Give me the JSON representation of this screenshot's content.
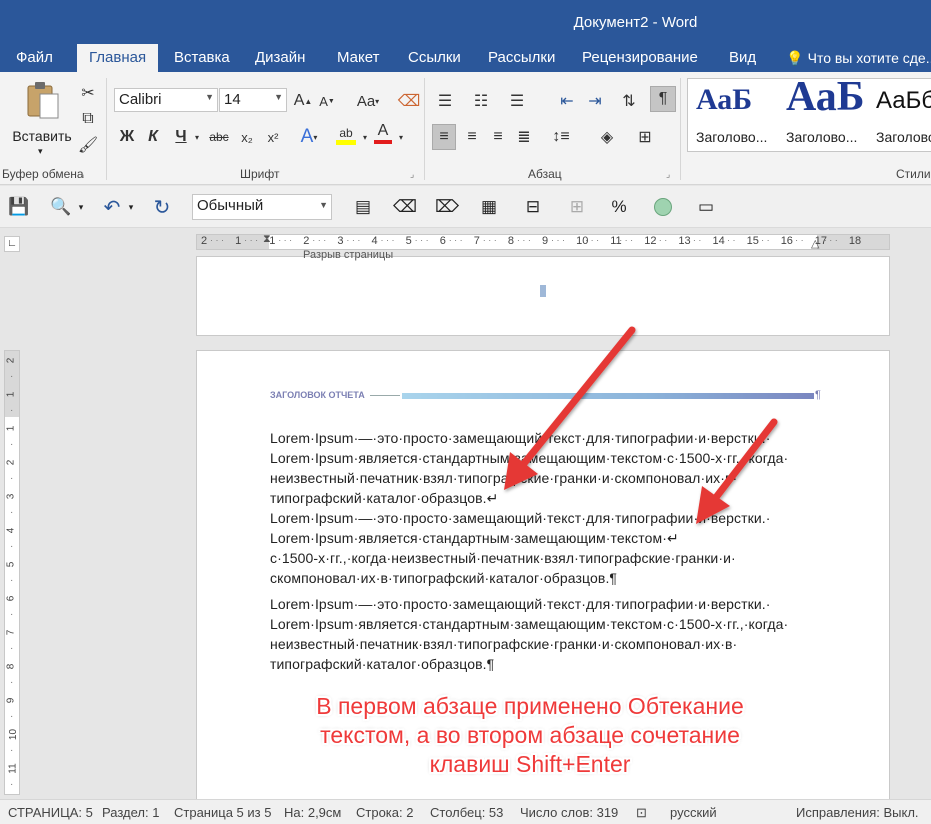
{
  "titlebar": {
    "title": "Документ2 - Word"
  },
  "tabs": [
    "Файл",
    "Главная",
    "Вставка",
    "Дизайн",
    "Макет",
    "Ссылки",
    "Рассылки",
    "Рецензирование",
    "Вид"
  ],
  "tell_me": "Что вы хотите сде...",
  "ribbon": {
    "clipboard": {
      "paste_label": "Вставить",
      "group_label": "Буфер обмена"
    },
    "font": {
      "font_name": "Calibri",
      "font_size": "14",
      "bold": "Ж",
      "italic": "К",
      "underline": "Ч",
      "strike": "abc",
      "grow": "A",
      "shrink": "A",
      "case": "Aa",
      "text_effect": "A",
      "highlight": "ab",
      "font_color": "A",
      "group_label": "Шрифт"
    },
    "paragraph": {
      "pilcrow": "¶",
      "group_label": "Абзац"
    },
    "styles": {
      "items": [
        {
          "preview": "АаБ",
          "label": "Заголово..."
        },
        {
          "preview": "АаБ",
          "label": "Заголово..."
        },
        {
          "preview": "АаБб",
          "label": "Заголово..."
        }
      ],
      "group_label": "Стили"
    }
  },
  "qat": {
    "style_value": "Обычный"
  },
  "ruler": {
    "labels": [
      "2",
      "1",
      "1",
      "2",
      "3",
      "4",
      "5",
      "6",
      "7",
      "8",
      "9",
      "10",
      "11",
      "12",
      "13",
      "14",
      "15",
      "16",
      "17",
      "18"
    ]
  },
  "vruler": {
    "labels": [
      "2",
      "1",
      "1",
      "2",
      "3",
      "4",
      "5",
      "6",
      "7",
      "8",
      "9",
      "10",
      "11"
    ]
  },
  "document": {
    "prev_page_text": "Разрыв страницы",
    "header_title": "ЗАГОЛОВОК ОТЧЕТА",
    "header_mark": "¶",
    "lines": [
      "Lorem·Ipsum·—·это·просто·замещающий·текст·для·типографии·и·верстки.·",
      "Lorem·Ipsum·является·стандартным·замещающим·текстом·с·1500-х·гг.,·когда·",
      "неизвестный·печатник·взял·типографские·гранки·и·скомпоновал·их·в·",
      "типографский·каталог·образцов.↵",
      "Lorem·Ipsum·—·это·просто·замещающий·текст·для·типографии·и·верстки.·",
      "Lorem·Ipsum·является·стандартным·замещающим·текстом·↵",
      "с·1500-х·гг.,·когда·неизвестный·печатник·взял·типографские·гранки·и·",
      "скомпоновал·их·в·типографский·каталог·образцов.¶",
      "Lorem·Ipsum·—·это·просто·замещающий·текст·для·типографии·и·верстки.·",
      "Lorem·Ipsum·является·стандартным·замещающим·текстом·с·1500-х·гг.,·когда·",
      "неизвестный·печатник·взял·типографские·гранки·и·скомпоновал·их·в·",
      "типографский·каталог·образцов.¶"
    ]
  },
  "annotation": {
    "line1": "В первом абзаце применено Обтекание",
    "line2": "текстом, а во втором абзаце сочетание",
    "line3": "клавиш Shift+Enter",
    "color": "#ef3a3a"
  },
  "statusbar": {
    "page": "СТРАНИЦА: 5",
    "section": "Раздел: 1",
    "page_of": "Страница 5 из 5",
    "at": "На: 2,9см",
    "line": "Строка: 2",
    "column": "Столбец: 53",
    "words": "Число слов: 319",
    "language": "русский",
    "track_changes": "Исправления: Выкл."
  },
  "colors": {
    "accent": "#2b579a",
    "arrow": "#e53935",
    "header_bar": "#9fc5e8",
    "header_text": "#7b7fb3"
  }
}
